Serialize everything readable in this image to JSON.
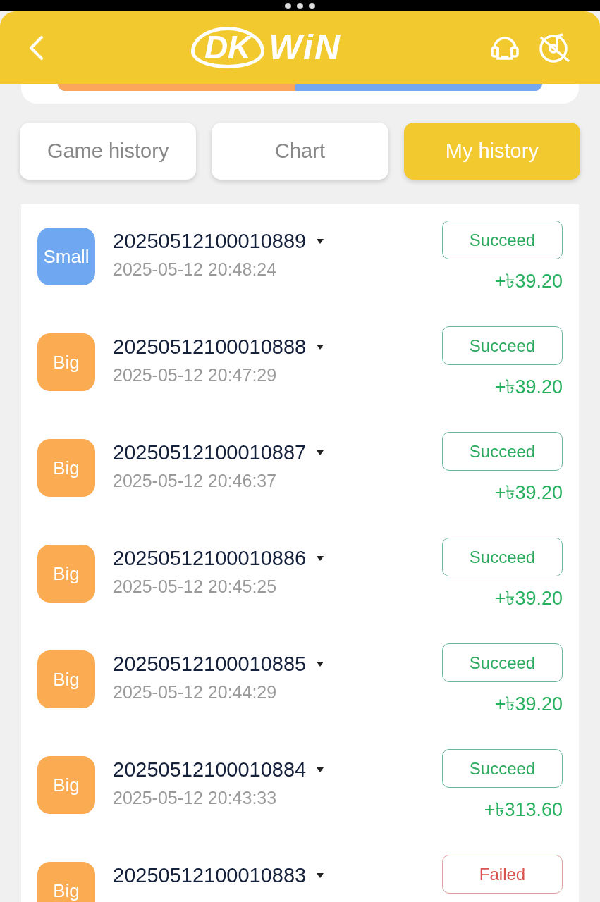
{
  "header": {
    "logo_mark": "DK",
    "logo_word": "WiN"
  },
  "ratio_bar": {
    "level": 0.49
  },
  "tabs": [
    {
      "label": "Game history",
      "selected": false
    },
    {
      "label": "Chart",
      "selected": false
    },
    {
      "label": "My history",
      "selected": true
    }
  ],
  "bets": [
    {
      "pick": "Small",
      "kind": "small",
      "period": "20250512100010889",
      "time": "2025-05-12 20:48:24",
      "status": "Succeed",
      "succeeded": true,
      "amount": "+৳39.20"
    },
    {
      "pick": "Big",
      "kind": "big",
      "period": "20250512100010888",
      "time": "2025-05-12 20:47:29",
      "status": "Succeed",
      "succeeded": true,
      "amount": "+৳39.20"
    },
    {
      "pick": "Big",
      "kind": "big",
      "period": "20250512100010887",
      "time": "2025-05-12 20:46:37",
      "status": "Succeed",
      "succeeded": true,
      "amount": "+৳39.20"
    },
    {
      "pick": "Big",
      "kind": "big",
      "period": "20250512100010886",
      "time": "2025-05-12 20:45:25",
      "status": "Succeed",
      "succeeded": true,
      "amount": "+৳39.20"
    },
    {
      "pick": "Big",
      "kind": "big",
      "period": "20250512100010885",
      "time": "2025-05-12 20:44:29",
      "status": "Succeed",
      "succeeded": true,
      "amount": "+৳39.20"
    },
    {
      "pick": "Big",
      "kind": "big",
      "period": "20250512100010884",
      "time": "2025-05-12 20:43:33",
      "status": "Succeed",
      "succeeded": true,
      "amount": "+৳313.60"
    },
    {
      "pick": "Big",
      "kind": "big",
      "period": "20250512100010883",
      "status": "Failed",
      "succeeded": false
    }
  ]
}
